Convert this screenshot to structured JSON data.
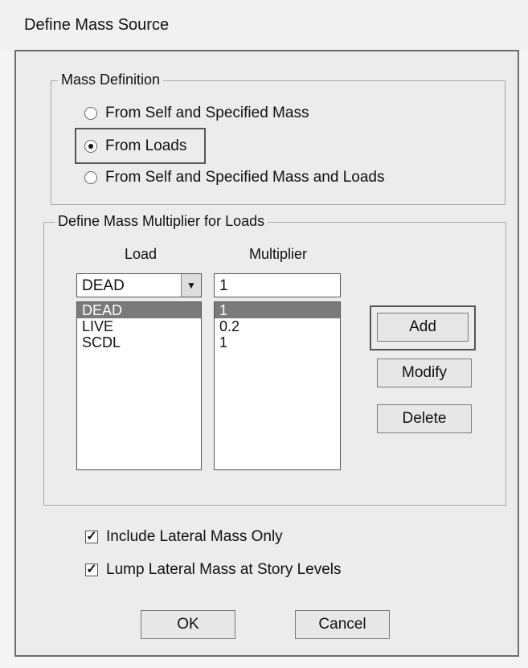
{
  "window": {
    "title": "Define Mass Source"
  },
  "mass_definition": {
    "legend": "Mass Definition",
    "options": [
      {
        "label": "From Self and Specified Mass",
        "selected": false
      },
      {
        "label": "From Loads",
        "selected": true
      },
      {
        "label": "From Self and Specified Mass and Loads",
        "selected": false
      }
    ]
  },
  "multiplier": {
    "legend": "Define Mass Multiplier for Loads",
    "load_header": "Load",
    "multiplier_header": "Multiplier",
    "load_combo_value": "DEAD",
    "multiplier_value": "1",
    "loads": [
      "DEAD",
      "LIVE",
      "SCDL"
    ],
    "multipliers": [
      "1",
      "0.2",
      "1"
    ],
    "selected_index": 0,
    "buttons": {
      "add": "Add",
      "modify": "Modify",
      "delete": "Delete"
    }
  },
  "options": {
    "include_lateral": {
      "label": "Include Lateral Mass Only",
      "checked": true
    },
    "lump_lateral": {
      "label": "Lump Lateral Mass at Story Levels",
      "checked": true
    }
  },
  "footer": {
    "ok": "OK",
    "cancel": "Cancel"
  }
}
